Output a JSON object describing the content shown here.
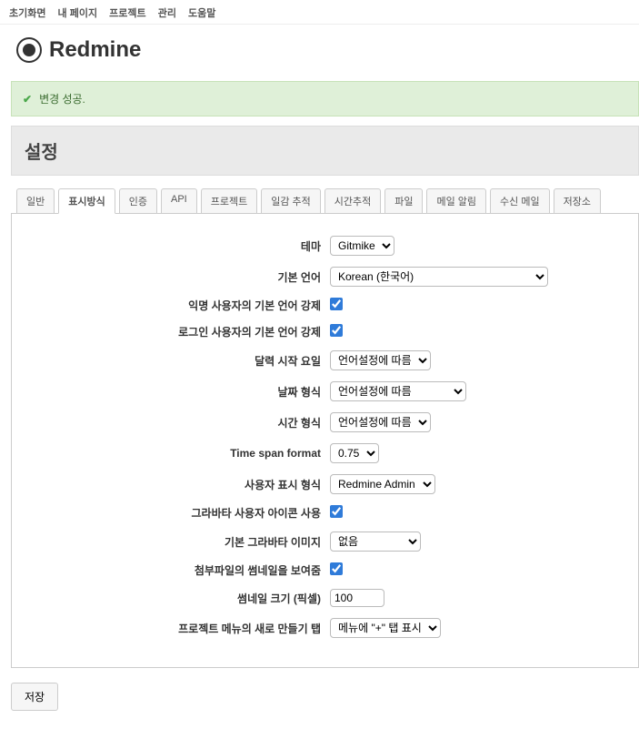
{
  "top_menu": {
    "home": "초기화면",
    "mypage": "내 페이지",
    "projects": "프로젝트",
    "admin": "관리",
    "help": "도움말"
  },
  "app_name": "Redmine",
  "flash": "변경 성공.",
  "page_title": "설정",
  "tabs": {
    "general": "일반",
    "display": "표시방식",
    "auth": "인증",
    "api": "API",
    "projects": "프로젝트",
    "issues": "일감 추적",
    "time": "시간추적",
    "files": "파일",
    "email": "메일 알림",
    "incoming": "수신 메일",
    "repo": "저장소"
  },
  "form": {
    "theme_label": "테마",
    "theme_value": "Gitmike",
    "lang_label": "기본 언어",
    "lang_value": "Korean (한국어)",
    "force_anon_label": "익명 사용자의 기본 언어 강제",
    "force_login_label": "로그인 사용자의 기본 언어 강제",
    "week_start_label": "달력 시작 요일",
    "week_start_value": "언어설정에 따름",
    "date_fmt_label": "날짜 형식",
    "date_fmt_value": "언어설정에 따름",
    "time_fmt_label": "시간 형식",
    "time_fmt_value": "언어설정에 따름",
    "timespan_label": "Time span format",
    "timespan_value": "0.75",
    "user_fmt_label": "사용자 표시 형식",
    "user_fmt_value": "Redmine Admin",
    "gravatar_label": "그라바타 사용자 아이콘 사용",
    "gravatar_default_label": "기본 그라바타 이미지",
    "gravatar_default_value": "없음",
    "thumb_label": "첨부파일의 썸네일을 보여줌",
    "thumb_size_label": "썸네일 크기 (픽셀)",
    "thumb_size_value": "100",
    "new_item_tab_label": "프로젝트 메뉴의 새로 만들기 탭",
    "new_item_tab_value": "메뉴에 \"+\" 탭 표시"
  },
  "save_label": "저장"
}
